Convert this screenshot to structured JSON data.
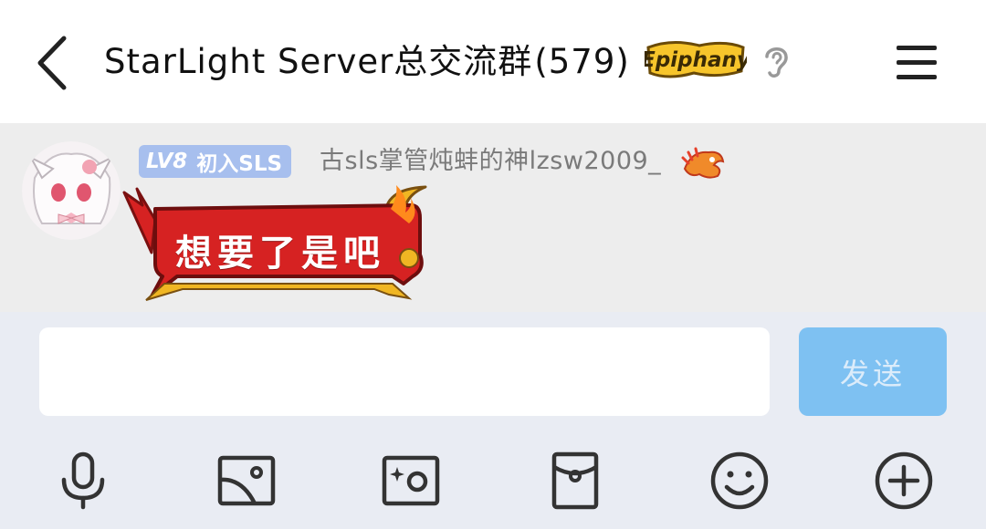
{
  "header": {
    "title": "StarLight Server总交流群",
    "member_count": "(579)",
    "group_badge_text": "Epiphany",
    "icons": [
      "back-arrow-icon",
      "ear-icon",
      "hamburger-menu-icon"
    ]
  },
  "message": {
    "level_badge": {
      "level": "LV8",
      "title": "初入SLS"
    },
    "sender": "古sls掌管炖蚌的神lzsw2009_",
    "text": "想要了是吧",
    "bubble_colors": {
      "fill": "#d62222",
      "border": "#f0b623"
    }
  },
  "composer": {
    "input_value": "",
    "input_placeholder": "",
    "send_label": "发送",
    "send_color": "#7ec1f2"
  },
  "toolbar": {
    "items": [
      "microphone-icon",
      "image-icon",
      "camera-icon",
      "red-packet-icon",
      "emoji-icon",
      "plus-icon"
    ]
  }
}
